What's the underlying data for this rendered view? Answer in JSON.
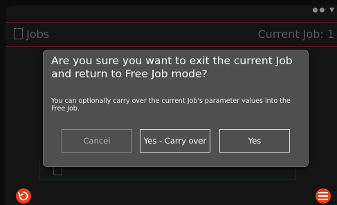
{
  "header": {
    "title": "Jobs",
    "current_job": "Current Job: 1"
  },
  "dialog": {
    "title": "Are you sure you want to exit the current Job and return to Free Job mode?",
    "body": "You can optionally carry over the current Job's parameter values into the Free Job.",
    "buttons": {
      "cancel": "Cancel",
      "carry_over": "Yes - Carry over",
      "yes": "Yes"
    }
  },
  "colors": {
    "accent": "#e8401c",
    "dialog_bg": "#4f4f4f",
    "screen_bg": "#141414"
  },
  "icons": {
    "status": "signal-icon wifi-icon",
    "back": "undo-icon",
    "menu": "hamburger-menu-icon"
  }
}
